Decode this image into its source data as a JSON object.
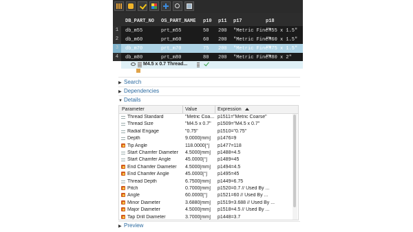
{
  "table": {
    "columns": [
      "DB_PART_NO",
      "OS_PART_NAME",
      "p10",
      "p11",
      "p17",
      "p18"
    ],
    "rows": [
      {
        "rownum": "1",
        "db_part_no": "db_m55",
        "os_part_name": "prt_m55",
        "p10": "50",
        "p11": "200",
        "p17": "\"Metric Fine\"",
        "p18": "\"M55 x 1.5\""
      },
      {
        "rownum": "2",
        "db_part_no": "db_m60",
        "os_part_name": "prt_m60",
        "p10": "60",
        "p11": "200",
        "p17": "\"Metric Fine\"",
        "p18": "\"M60 x 1.5\""
      },
      {
        "rownum": "3",
        "db_part_no": "db_m70",
        "os_part_name": "prt_m70",
        "p10": "75",
        "p11": "200",
        "p17": "\"Metric Fine\"",
        "p18": "\"M75 x 1.5\""
      },
      {
        "rownum": "4",
        "db_part_no": "db_m80",
        "os_part_name": "prt_m80",
        "p10": "80",
        "p11": "200",
        "p17": "\"Metric Fine\"",
        "p18": "\"M80 x 2\""
      }
    ],
    "selected_row": 3
  },
  "tree": {
    "feature_label": "M4.5 x 0.7 Thread...",
    "status_icon": "check-icon"
  },
  "sections": {
    "search": "Search",
    "dependencies": "Dependencies",
    "details": "Details",
    "preview": "Preview"
  },
  "details": {
    "headers": {
      "parameter": "Parameter",
      "value": "Value",
      "expression": "Expression"
    },
    "rows": [
      {
        "icon": "equals-icon",
        "parameter": "Thread Standard",
        "value": "\"Metric Coa...",
        "expression": "p1511=\"Metric Coarse\""
      },
      {
        "icon": "equals-icon",
        "parameter": "Thread Size",
        "value": "\"M4.5 x 0.7\"",
        "expression": "p1509=\"M4.5 x 0.7\""
      },
      {
        "icon": "equals-icon",
        "parameter": "Radial Engage",
        "value": "\"0.75\"",
        "expression": "p1510=\"0.75\""
      },
      {
        "icon": "equals-icon",
        "parameter": "Depth",
        "value": "9.0000[mm]",
        "expression": "p1476=9"
      },
      {
        "icon": "formula-icon",
        "parameter": "Tip Angle",
        "value": "118.0000[°]",
        "expression": "p1477=118"
      },
      {
        "icon": "equals-icon",
        "parameter": "Start Chamfer Diameter",
        "value": "4.5000[mm]",
        "expression": "p1488=4.5"
      },
      {
        "icon": "equals-icon",
        "parameter": "Start Chamfer Angle",
        "value": "45.0000[°]",
        "expression": "p1489=45"
      },
      {
        "icon": "formula-icon",
        "parameter": "End Chamfer Diameter",
        "value": "4.5000[mm]",
        "expression": "p1494=4.5"
      },
      {
        "icon": "formula-icon",
        "parameter": "End Chamfer Angle",
        "value": "45.0000[°]",
        "expression": "p1495=45"
      },
      {
        "icon": "equals-icon",
        "parameter": "Thread Depth",
        "value": "6.7500[mm]",
        "expression": "p1449=6.75"
      },
      {
        "icon": "formula-icon",
        "parameter": "Pitch",
        "value": "0.7000[mm]",
        "expression": "p1520=0.7 // Used By ..."
      },
      {
        "icon": "formula-icon",
        "parameter": "Angle",
        "value": "60.0000[°]",
        "expression": "p1521=60 // Used By ..."
      },
      {
        "icon": "formula-icon",
        "parameter": "Minor Diameter",
        "value": "3.6880[mm]",
        "expression": "p1519=3.688 // Used By ..."
      },
      {
        "icon": "formula-icon",
        "parameter": "Major Diameter",
        "value": "4.5000[mm]",
        "expression": "p1518=4.5 // Used By ..."
      },
      {
        "icon": "formula-icon",
        "parameter": "Tap Drill Diameter",
        "value": "3.7000[mm]",
        "expression": "p1448=3.7"
      }
    ]
  },
  "colors": {
    "toolbar_bg": "#2b2b2b",
    "table_bg": "#1b1b1b",
    "selected_row": "#aed4e6",
    "section_text": "#2b6aa0",
    "formula_icon": "#d2581b"
  }
}
